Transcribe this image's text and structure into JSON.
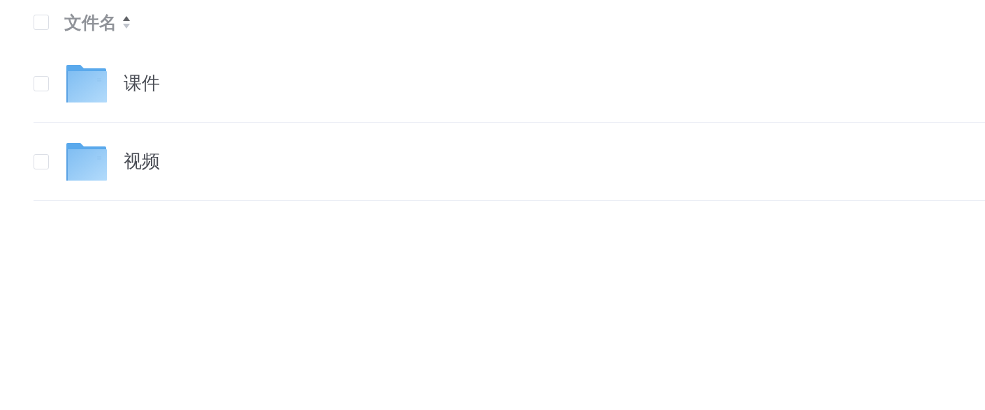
{
  "header": {
    "checked": false,
    "label": "文件名",
    "sort_ascending": true
  },
  "rows": [
    {
      "name": "课件",
      "checked": false
    },
    {
      "name": "视频",
      "checked": false
    }
  ]
}
